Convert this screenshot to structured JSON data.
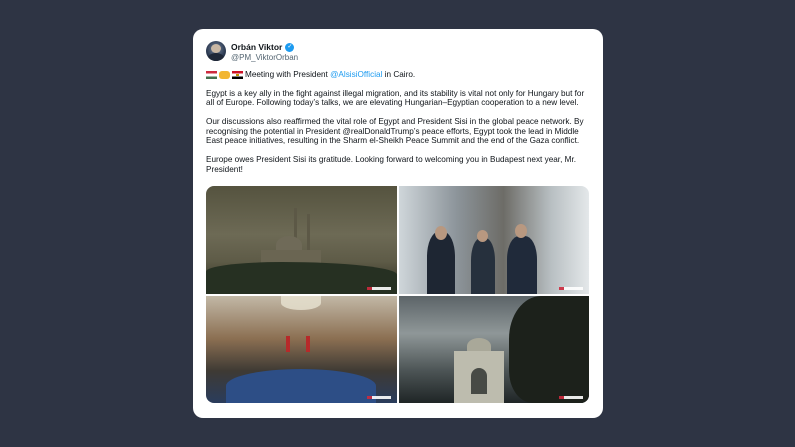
{
  "tweet": {
    "author_name": "Orbán Viktor",
    "handle": "@PM_ViktorOrban",
    "line1_prefix": "Meeting with President",
    "mention": "@AlsisiOfficial",
    "line1_suffix": "in Cairo.",
    "para2": "Egypt is a key ally in the fight against illegal migration, and its stability is vital not only for Hungary but for all of Europe. Following today’s talks, we are elevating Hungarian–Egyptian cooperation to a new level.",
    "para3": "Our discussions also reaffirmed the vital role of Egypt and President Sisi in the global peace network. By recognising the potential in President @realDonaldTrump’s peace efforts, Egypt took the lead in Middle East peace initiatives, resulting in the Sharm el-Sheikh Peace Summit and the end of the Gaza conflict.",
    "para4": "Europe owes President Sisi its gratitude. Looking forward to welcoming you in Budapest next year, Mr. President!",
    "flags": [
      "hungary-flag",
      "handshake",
      "egypt-flag"
    ]
  },
  "colors": {
    "background": "#2e3444",
    "card": "#ffffff",
    "link": "#1d9bf0",
    "text": "#0f1419",
    "muted": "#536471"
  }
}
